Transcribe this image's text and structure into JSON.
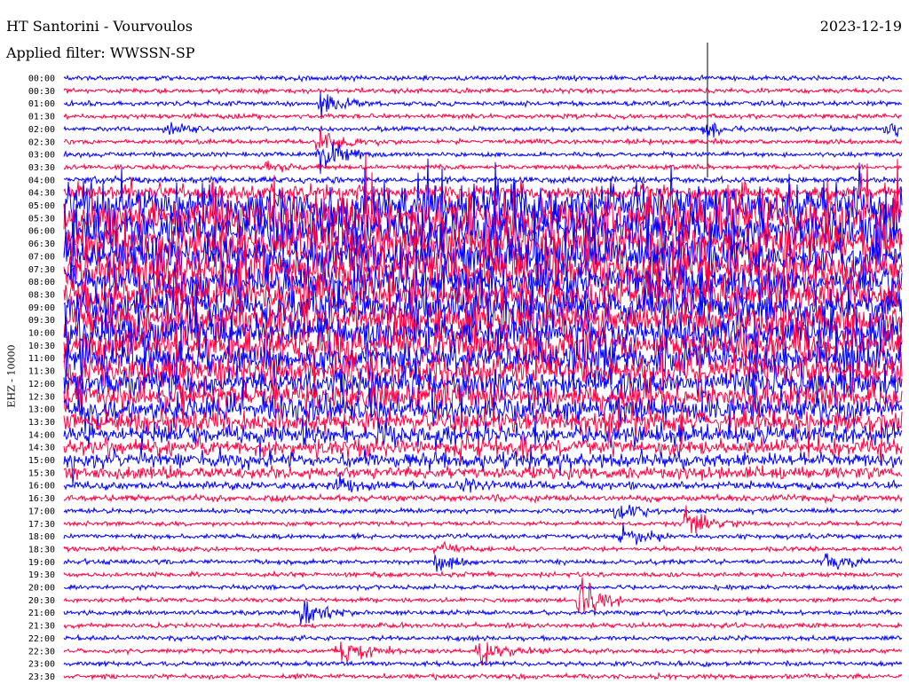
{
  "header": {
    "title": "HT Santorini - Vourvoulos",
    "filter": "Applied filter: WWSSN-SP",
    "date": "2023-12-19",
    "channel": "EHZ - 10000"
  },
  "chart_data": {
    "type": "line",
    "title": "HT Santorini - Vourvoulos",
    "subtitle": "Applied filter: WWSSN-SP",
    "ylabel": "EHZ - 10000",
    "minutes_per_line": 30,
    "colors": [
      "#0000ff",
      "#ff0040"
    ],
    "row_labels": [
      "00:00",
      "00:30",
      "01:00",
      "01:30",
      "02:00",
      "02:30",
      "03:00",
      "03:30",
      "04:00",
      "04:30",
      "05:00",
      "05:30",
      "06:00",
      "06:30",
      "07:00",
      "07:30",
      "08:00",
      "08:30",
      "09:00",
      "09:30",
      "10:00",
      "10:30",
      "11:00",
      "11:30",
      "12:00",
      "12:30",
      "13:00",
      "13:30",
      "14:00",
      "14:30",
      "15:00",
      "15:30",
      "16:00",
      "16:30",
      "17:00",
      "17:30",
      "18:00",
      "18:30",
      "19:00",
      "19:30",
      "20:00",
      "20:30",
      "21:00",
      "21:30",
      "22:00",
      "22:30",
      "23:00",
      "23:30"
    ],
    "noise_level": [
      3,
      3,
      3,
      3,
      3,
      3,
      3,
      3,
      4,
      10,
      26,
      28,
      28,
      28,
      26,
      26,
      24,
      24,
      22,
      22,
      22,
      22,
      20,
      20,
      18,
      18,
      16,
      14,
      12,
      10,
      9,
      8,
      5,
      4,
      3,
      3,
      3,
      3,
      3,
      3,
      3,
      3,
      3,
      3,
      3,
      3,
      3,
      3
    ],
    "events": [
      {
        "row": 2,
        "minute": 9.2,
        "amp": 18
      },
      {
        "row": 4,
        "minute": 23.0,
        "amp": 12
      },
      {
        "row": 4,
        "minute": 3.7,
        "amp": 6
      },
      {
        "row": 4,
        "minute": 29.5,
        "amp": 8
      },
      {
        "row": 5,
        "minute": 9.1,
        "amp": 20
      },
      {
        "row": 6,
        "minute": 9.2,
        "amp": 30
      },
      {
        "row": 7,
        "minute": 7.3,
        "amp": 10
      },
      {
        "row": 32,
        "minute": 9.8,
        "amp": 12
      },
      {
        "row": 32,
        "minute": 14.2,
        "amp": 12
      },
      {
        "row": 34,
        "minute": 19.8,
        "amp": 14
      },
      {
        "row": 35,
        "minute": 22.3,
        "amp": 20
      },
      {
        "row": 36,
        "minute": 20.0,
        "amp": 18
      },
      {
        "row": 37,
        "minute": 13.4,
        "amp": 10
      },
      {
        "row": 38,
        "minute": 13.3,
        "amp": 14
      },
      {
        "row": 38,
        "minute": 27.2,
        "amp": 14
      },
      {
        "row": 41,
        "minute": 18.5,
        "amp": 30
      },
      {
        "row": 42,
        "minute": 8.6,
        "amp": 22
      },
      {
        "row": 45,
        "minute": 9.9,
        "amp": 22
      },
      {
        "row": 45,
        "minute": 14.9,
        "amp": 22
      }
    ]
  }
}
